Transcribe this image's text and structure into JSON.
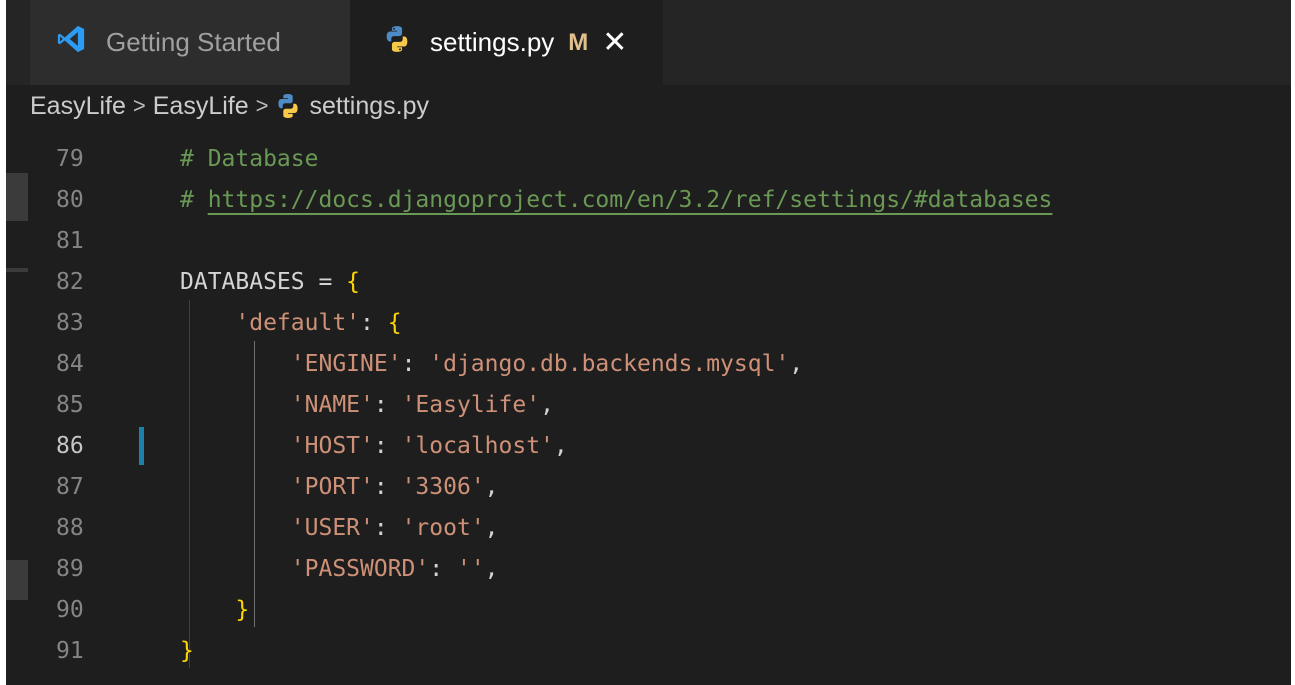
{
  "tabs": [
    {
      "label": "Getting Started",
      "icon": "vscode-logo-icon",
      "active": false
    },
    {
      "label": "settings.py",
      "icon": "python-icon",
      "active": true,
      "modified_badge": "M",
      "close_glyph": "✕"
    }
  ],
  "breadcrumb": {
    "items": [
      "EasyLife",
      "EasyLife",
      "settings.py"
    ],
    "separator": ">"
  },
  "editor": {
    "lines": [
      {
        "number": "79",
        "tokens": [
          {
            "t": "# Database",
            "c": "comment"
          }
        ]
      },
      {
        "number": "80",
        "tokens": [
          {
            "t": "# ",
            "c": "comment"
          },
          {
            "t": "https://docs.djangoproject.com/en/3.2/ref/settings/#databases",
            "c": "link"
          }
        ]
      },
      {
        "number": "81",
        "tokens": []
      },
      {
        "number": "82",
        "tokens": [
          {
            "t": "DATABASES",
            "c": "var"
          },
          {
            "t": " = ",
            "c": "punc"
          },
          {
            "t": "{",
            "c": "brace"
          }
        ]
      },
      {
        "number": "83",
        "tokens": [
          {
            "t": "    ",
            "c": "punc"
          },
          {
            "t": "'default'",
            "c": "str"
          },
          {
            "t": ": ",
            "c": "punc"
          },
          {
            "t": "{",
            "c": "brace"
          }
        ]
      },
      {
        "number": "84",
        "tokens": [
          {
            "t": "        ",
            "c": "punc"
          },
          {
            "t": "'ENGINE'",
            "c": "str"
          },
          {
            "t": ": ",
            "c": "punc"
          },
          {
            "t": "'django.db.backends.mysql'",
            "c": "str"
          },
          {
            "t": ",",
            "c": "punc"
          }
        ]
      },
      {
        "number": "85",
        "tokens": [
          {
            "t": "        ",
            "c": "punc"
          },
          {
            "t": "'NAME'",
            "c": "str"
          },
          {
            "t": ": ",
            "c": "punc"
          },
          {
            "t": "'Easylife'",
            "c": "str"
          },
          {
            "t": ",",
            "c": "punc"
          }
        ]
      },
      {
        "number": "86",
        "tokens": [
          {
            "t": "        ",
            "c": "punc"
          },
          {
            "t": "'HOST'",
            "c": "str"
          },
          {
            "t": ": ",
            "c": "punc"
          },
          {
            "t": "'localhost'",
            "c": "str"
          },
          {
            "t": ",",
            "c": "punc"
          }
        ],
        "active": true,
        "modified": true
      },
      {
        "number": "87",
        "tokens": [
          {
            "t": "        ",
            "c": "punc"
          },
          {
            "t": "'PORT'",
            "c": "str"
          },
          {
            "t": ": ",
            "c": "punc"
          },
          {
            "t": "'3306'",
            "c": "str"
          },
          {
            "t": ",",
            "c": "punc"
          }
        ]
      },
      {
        "number": "88",
        "tokens": [
          {
            "t": "        ",
            "c": "punc"
          },
          {
            "t": "'USER'",
            "c": "str"
          },
          {
            "t": ": ",
            "c": "punc"
          },
          {
            "t": "'root'",
            "c": "str"
          },
          {
            "t": ",",
            "c": "punc"
          }
        ]
      },
      {
        "number": "89",
        "tokens": [
          {
            "t": "        ",
            "c": "punc"
          },
          {
            "t": "'PASSWORD'",
            "c": "str"
          },
          {
            "t": ": ",
            "c": "punc"
          },
          {
            "t": "''",
            "c": "str"
          },
          {
            "t": ",",
            "c": "punc"
          }
        ]
      },
      {
        "number": "90",
        "tokens": [
          {
            "t": "    ",
            "c": "punc"
          },
          {
            "t": "}",
            "c": "brace"
          }
        ]
      },
      {
        "number": "91",
        "tokens": [
          {
            "t": "}",
            "c": "brace"
          }
        ]
      }
    ]
  },
  "colors": {
    "background": "#1e1e1e",
    "comment": "#6a9955",
    "string": "#ce9178",
    "brace": "#ffd700",
    "modified_badge": "#e2c08d",
    "modified_gutter": "#1b81a8"
  }
}
